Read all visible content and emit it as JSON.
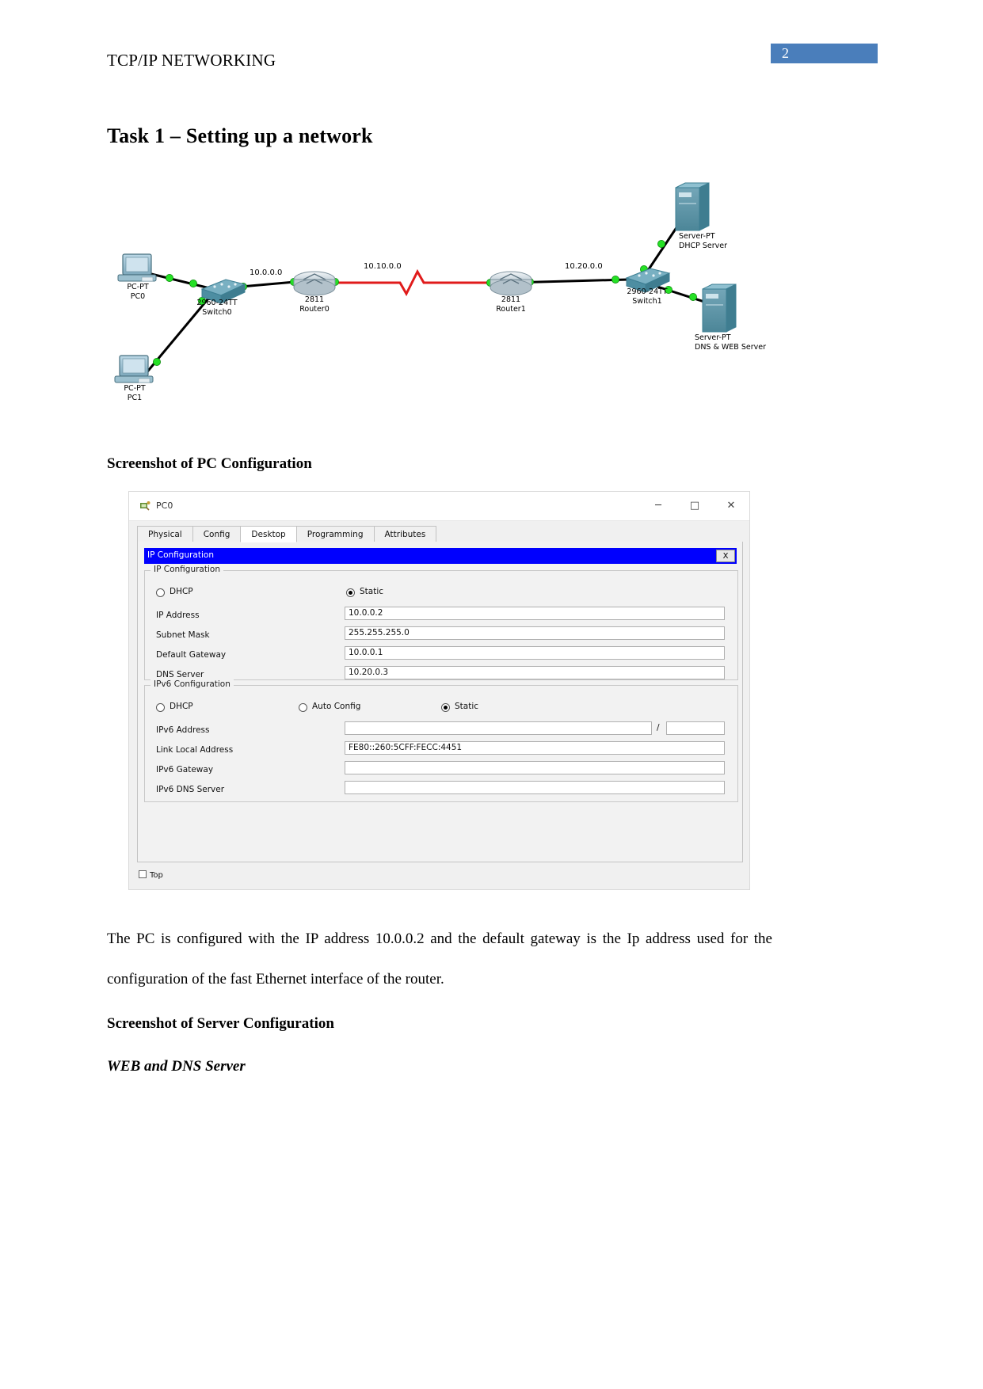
{
  "page": {
    "running_head": "TCP/IP NETWORKING",
    "page_number": "2",
    "page_number_color": "#4a7ebb"
  },
  "headings": {
    "task_title": "Task 1 – Setting up a network",
    "pc_config": "Screenshot of PC Configuration",
    "server_config": "Screenshot of Server Configuration",
    "web_dns_server": "WEB and DNS Server"
  },
  "paragraph": {
    "pc_description": "The PC is configured with the IP address 10.0.0.2 and the default gateway is the Ip address used for the configuration of the fast Ethernet interface of the router."
  },
  "diagram": {
    "devices": [
      {
        "id": "pc0",
        "model": "PC-PT",
        "name": "PC0"
      },
      {
        "id": "pc1",
        "model": "PC-PT",
        "name": "PC1"
      },
      {
        "id": "switch0",
        "model": "2960-24TT",
        "name": "Switch0"
      },
      {
        "id": "router0",
        "model": "2811",
        "name": "Router0"
      },
      {
        "id": "router1",
        "model": "2811",
        "name": "Router1"
      },
      {
        "id": "switch1",
        "model": "2960-24TT",
        "name": "Switch1"
      },
      {
        "id": "dhcp",
        "model": "Server-PT",
        "name": "DHCP Server"
      },
      {
        "id": "dnsweb",
        "model": "Server-PT",
        "name": "DNS & WEB Server"
      }
    ],
    "network_labels": [
      {
        "id": "net1",
        "text": "10.0.0.0"
      },
      {
        "id": "net2",
        "text": "10.10.0.0"
      },
      {
        "id": "net3",
        "text": "10.20.0.0"
      }
    ],
    "link_colors": {
      "ethernet": "#000000",
      "serial": "#e01b1b",
      "status_up": "#22dd22"
    }
  },
  "pt_window": {
    "title": "PC0",
    "controls": {
      "minimize": "─",
      "maximize": "□",
      "close": "✕"
    },
    "tabs": [
      {
        "label": "Physical",
        "active": false
      },
      {
        "label": "Config",
        "active": false
      },
      {
        "label": "Desktop",
        "active": true
      },
      {
        "label": "Programming",
        "active": false
      },
      {
        "label": "Attributes",
        "active": false
      }
    ],
    "ip_config_panel": {
      "titlebar": "IP Configuration",
      "close_button": "X",
      "ipv4": {
        "legend": "IP Configuration",
        "mode_options": [
          {
            "label": "DHCP",
            "selected": false
          },
          {
            "label": "Static",
            "selected": true
          }
        ],
        "fields": [
          {
            "label": "IP Address",
            "value": "10.0.0.2"
          },
          {
            "label": "Subnet Mask",
            "value": "255.255.255.0"
          },
          {
            "label": "Default Gateway",
            "value": "10.0.0.1"
          },
          {
            "label": "DNS Server",
            "value": "10.20.0.3"
          }
        ]
      },
      "ipv6": {
        "legend": "IPv6 Configuration",
        "mode_options": [
          {
            "label": "DHCP",
            "selected": false
          },
          {
            "label": "Auto Config",
            "selected": false
          },
          {
            "label": "Static",
            "selected": true
          }
        ],
        "fields": [
          {
            "label": "IPv6 Address",
            "value": "",
            "has_prefix": true,
            "prefix_value": ""
          },
          {
            "label": "Link Local Address",
            "value": "FE80::260:5CFF:FECC:4451"
          },
          {
            "label": "IPv6 Gateway",
            "value": ""
          },
          {
            "label": "IPv6 DNS Server",
            "value": ""
          }
        ],
        "prefix_separator": "/"
      }
    },
    "footer": {
      "top_checkbox_label": "Top",
      "top_checked": false
    }
  }
}
